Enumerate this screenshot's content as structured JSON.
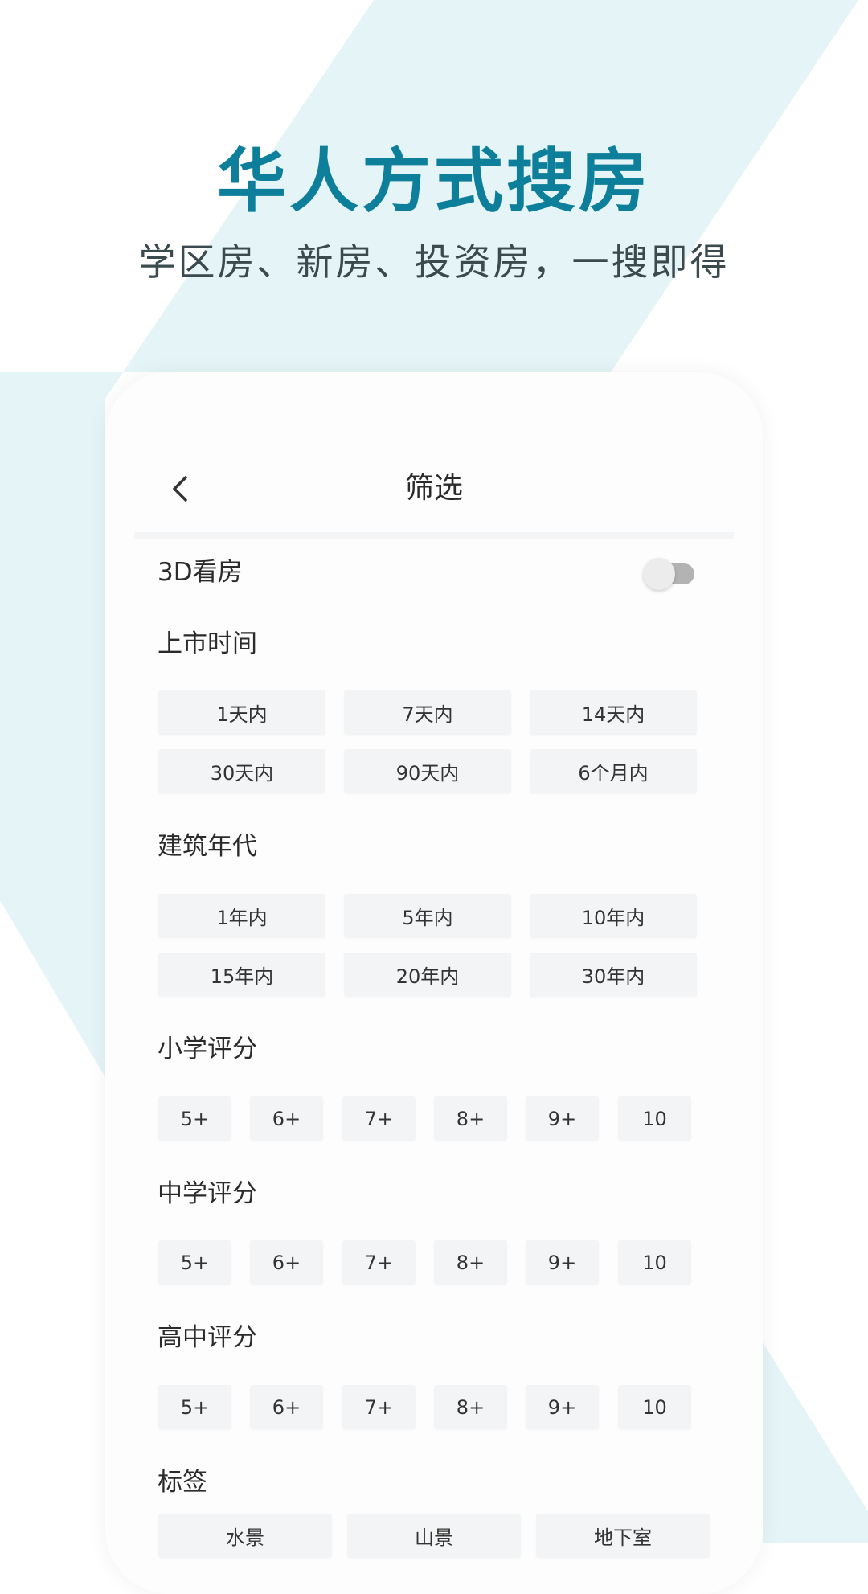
{
  "colors": {
    "accent": "#0d7f9a",
    "background_shape": "#e4f4f7",
    "chip_background": "#f3f4f6",
    "toggle_off_track": "#b3b3b3"
  },
  "hero": {
    "title": "华人方式搜房",
    "subtitle": "学区房、新房、投资房，一搜即得"
  },
  "header": {
    "back_icon": "chevron-left-icon",
    "title": "筛选"
  },
  "toggle_3d": {
    "label": "3D看房",
    "on": false
  },
  "sections": {
    "listing_time": {
      "label": "上市时间",
      "options": [
        "1天内",
        "7天内",
        "14天内",
        "30天内",
        "90天内",
        "6个月内"
      ]
    },
    "build_year": {
      "label": "建筑年代",
      "options": [
        "1年内",
        "5年内",
        "10年内",
        "15年内",
        "20年内",
        "30年内"
      ]
    },
    "primary_school": {
      "label": "小学评分",
      "options": [
        "5+",
        "6+",
        "7+",
        "8+",
        "9+",
        "10"
      ]
    },
    "middle_school": {
      "label": "中学评分",
      "options": [
        "5+",
        "6+",
        "7+",
        "8+",
        "9+",
        "10"
      ]
    },
    "high_school": {
      "label": "高中评分",
      "options": [
        "5+",
        "6+",
        "7+",
        "8+",
        "9+",
        "10"
      ]
    },
    "tags": {
      "label": "标签",
      "options": [
        "水景",
        "山景",
        "地下室"
      ]
    }
  }
}
